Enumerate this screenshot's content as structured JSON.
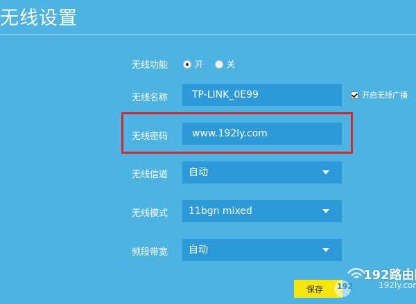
{
  "page": {
    "title": "无线设置"
  },
  "wireless_function": {
    "label": "无线功能",
    "options": [
      {
        "label": "开",
        "checked": true
      },
      {
        "label": "关",
        "checked": false
      }
    ]
  },
  "wireless_name": {
    "label": "无线名称",
    "value": "TP-LINK_0E99",
    "broadcast_label": "开启无线广播",
    "broadcast_checked": true
  },
  "wireless_password": {
    "label": "无线密码",
    "value": "www.192ly.com"
  },
  "wireless_channel": {
    "label": "无线信道",
    "value": "自动"
  },
  "wireless_mode": {
    "label": "无线模式",
    "value": "11bgn mixed"
  },
  "bandwidth": {
    "label": "频段带宽",
    "value": "自动"
  },
  "actions": {
    "save_label": "保存"
  },
  "watermark": {
    "brand": "192路由网",
    "url": "192ly.com",
    "badge": "192"
  },
  "colors": {
    "background": "#4db3e0",
    "field": "#2b9ad7",
    "highlight": "#d6272c",
    "save_button": "#f6e60d"
  }
}
